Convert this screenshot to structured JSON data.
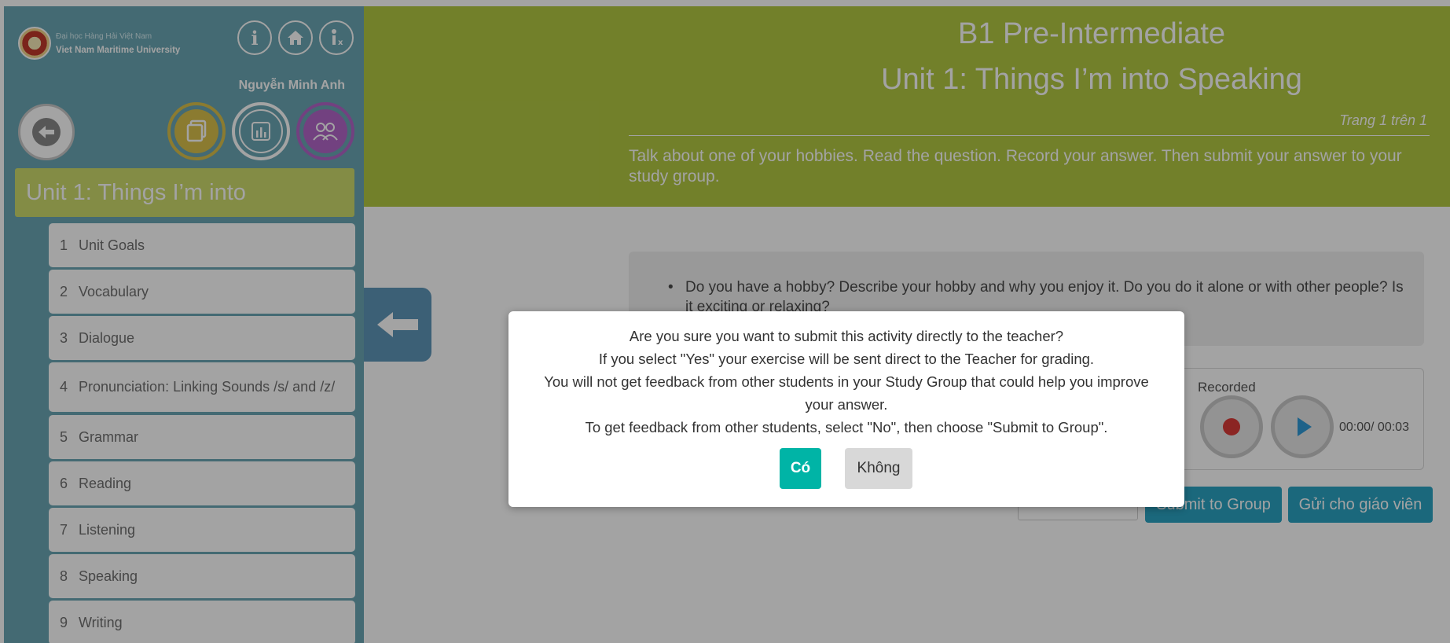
{
  "colors": {
    "sidebar_bg": "#6ba7b4",
    "header_bg": "#b3c843",
    "unit_banner_bg": "#cddc6d",
    "accent_button": "#2ba3c2",
    "yes_button": "#00b4a6",
    "no_button": "#d8d8d8",
    "record_dot": "#d93a37",
    "play_icon": "#2f9ad6",
    "ring_gold": "#d9c04b",
    "ring_purple": "#b266c9"
  },
  "sidebar": {
    "university_vn": "Đại học Hàng Hải Việt Nam",
    "university_en": "Viet Nam Maritime University",
    "top_icons": [
      "info-icon",
      "home-icon",
      "accessibility-icon"
    ],
    "user_name": "Nguyễn Minh Anh",
    "nav_icons": [
      "back-icon",
      "cards-icon",
      "chart-icon",
      "group-icon"
    ],
    "unit_title": "Unit 1: Things I’m into",
    "lessons": [
      {
        "num": "1",
        "title": "Unit Goals"
      },
      {
        "num": "2",
        "title": "Vocabulary"
      },
      {
        "num": "3",
        "title": "Dialogue"
      },
      {
        "num": "4",
        "title": "Pronunciation: Linking Sounds /s/ and /z/"
      },
      {
        "num": "5",
        "title": "Grammar"
      },
      {
        "num": "6",
        "title": "Reading"
      },
      {
        "num": "7",
        "title": "Listening"
      },
      {
        "num": "8",
        "title": "Speaking"
      },
      {
        "num": "9",
        "title": "Writing"
      }
    ]
  },
  "header": {
    "course": "B1 Pre-Intermediate",
    "unit": "Unit 1: Things I’m into Speaking",
    "page_info": "Trang 1 trên 1",
    "instruction": "Talk about one of your hobbies. Read the question. Record your answer. Then submit your answer to your study group."
  },
  "question": "Do you have a hobby? Describe your hobby and why you enjoy it. Do you do it alone or with other people? Is it exciting or relaxing?",
  "recorder": {
    "label": "Recorded",
    "time": "00:00/ 00:03"
  },
  "actions": {
    "submit_group": "Submit to Group",
    "send_teacher": "Gửi cho giáo viên"
  },
  "dialog": {
    "lines": [
      "Are you sure you want to submit this activity directly to the teacher?",
      "If you select \"Yes\" your exercise will be sent direct to the Teacher for grading.",
      "You will not get feedback from other students in your Study Group that could help you improve your answer.",
      "To get feedback from other students, select \"No\", then choose \"Submit to Group\"."
    ],
    "yes": "Có",
    "no": "Không"
  }
}
